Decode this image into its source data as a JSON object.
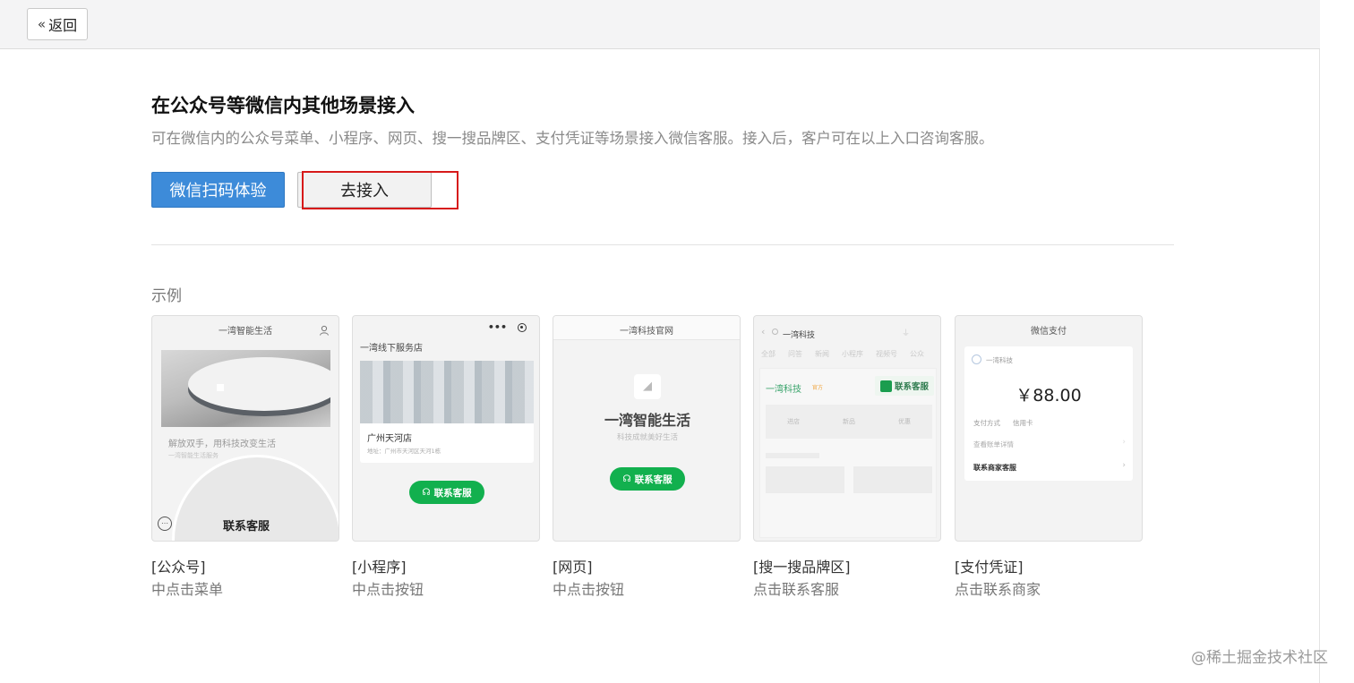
{
  "topbar": {
    "back_label": "返回",
    "back_icon": "double-chevron-left-icon"
  },
  "main": {
    "heading": "在公众号等微信内其他场景接入",
    "description": "可在微信内的公众号菜单、小程序、网页、搜一搜品牌区、支付凭证等场景接入微信客服。接入后，客户可在以上入口咨询客服。",
    "scan_button": "微信扫码体验",
    "go_button": "去接入",
    "example_label": "示例"
  },
  "cards": [
    {
      "title": "一湾智能生活",
      "banner_text": "解放双手，用科技改变生活",
      "banner_sub": "一湾智能生活服务",
      "menu_label": "联系客服",
      "caption1": "[公众号]",
      "caption2": "中点击菜单"
    },
    {
      "title": "一湾线下服务店",
      "store_name": "广州天河店",
      "store_addr": "地址：广州市天河区天河1栋",
      "button": "联系客服",
      "caption1": "[小程序]",
      "caption2": "中点击按钮"
    },
    {
      "title": "一湾科技官网",
      "hero": "一湾智能生活",
      "hero_sub": "科技成就美好生活",
      "button": "联系客服",
      "caption1": "[网页]",
      "caption2": "中点击按钮"
    },
    {
      "title": "一湾科技",
      "tabs": [
        "全部",
        "问答",
        "新闻",
        "小程序",
        "视频号",
        "公众"
      ],
      "brand": "一湾科技",
      "brand_badge": "官方",
      "button": "联系客服",
      "icons": [
        "进店",
        "新品",
        "优惠"
      ],
      "caption1": "[搜一搜品牌区]",
      "caption2": "点击联系客服"
    },
    {
      "title": "微信支付",
      "merchant": "一湾科技",
      "amount": "￥88.00",
      "pay_method_label": "支付方式",
      "pay_method_value": "信用卡",
      "order_detail": "查看账单详情",
      "contact": "联系商家客服",
      "caption1": "[支付凭证]",
      "caption2": "点击联系商家"
    }
  ],
  "watermark": "@稀土掘金技术社区",
  "colors": {
    "primary": "#3d8bd9",
    "highlight": "#d71a1a",
    "wechat_green": "#12b04e"
  }
}
